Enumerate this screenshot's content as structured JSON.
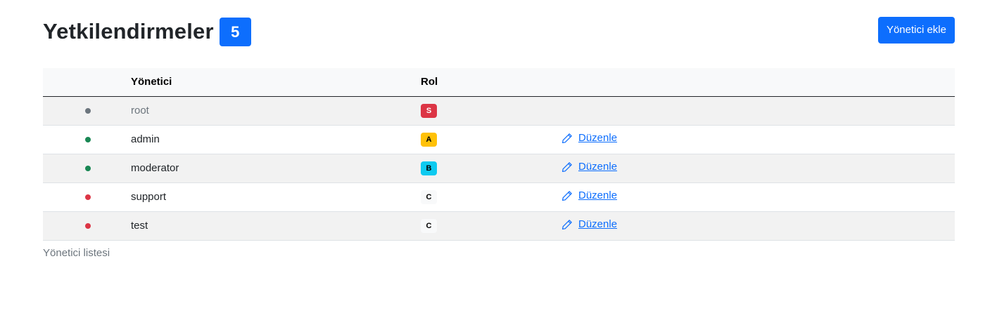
{
  "header": {
    "title": "Yetkilendirmeler",
    "count": "5",
    "add_button_label": "Yönetici ekle"
  },
  "table": {
    "columns": [
      "",
      "Yönetici",
      "Rol",
      ""
    ],
    "rows": [
      {
        "status_color": "#6c757d",
        "username": "root",
        "username_color": "#6c757d",
        "role": "S",
        "role_bg": "#dc3545",
        "role_fg": "#ffffff",
        "action": ""
      },
      {
        "status_color": "#198754",
        "username": "admin",
        "username_color": "#212529",
        "role": "A",
        "role_bg": "#ffc107",
        "role_fg": "#000000",
        "action": "Düzenle"
      },
      {
        "status_color": "#198754",
        "username": "moderator",
        "username_color": "#212529",
        "role": "B",
        "role_bg": "#0dcaf0",
        "role_fg": "#000000",
        "action": "Düzenle"
      },
      {
        "status_color": "#dc3545",
        "username": "support",
        "username_color": "#212529",
        "role": "C",
        "role_bg": "#f8f9fa",
        "role_fg": "#000000",
        "action": "Düzenle"
      },
      {
        "status_color": "#dc3545",
        "username": "test",
        "username_color": "#212529",
        "role": "C",
        "role_bg": "#f8f9fa",
        "role_fg": "#000000",
        "action": "Düzenle"
      }
    ],
    "caption": "Yönetici listesi"
  },
  "icons": {
    "edit": "pencil-icon",
    "status": "status-dot"
  },
  "colors": {
    "primary": "#0d6efd"
  }
}
